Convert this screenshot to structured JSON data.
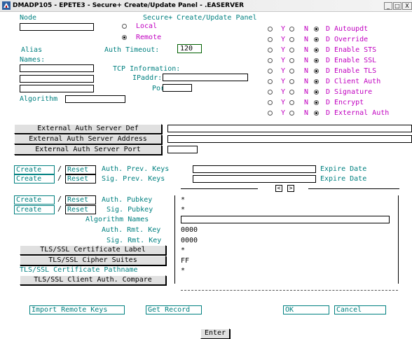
{
  "window": {
    "title": "DMADP105 - EPETE3 - Secure+ Create/Update Panel - .EASERVER",
    "minimize": "_",
    "maximize": "□",
    "close": "X"
  },
  "panel_title": "Secure+ Create/Update Panel",
  "node": {
    "label": "Node",
    "value": ""
  },
  "location": {
    "local": "Local",
    "remote": "Remote",
    "selected": "remote"
  },
  "alias": {
    "label": "Alias"
  },
  "auth_timeout": {
    "label": "Auth Timeout:",
    "value": "120"
  },
  "names": {
    "label": "Names:"
  },
  "tcp": {
    "label": "TCP Information:",
    "ipaddr_label": "IPaddr:",
    "port_label": "Port:"
  },
  "algorithm": {
    "label": "Algorithm"
  },
  "options": {
    "y": "Y",
    "n": "N",
    "d": "D",
    "items": [
      {
        "label": "Autoupdt",
        "selected": "N"
      },
      {
        "label": "Override",
        "selected": "N"
      },
      {
        "label": "Enable STS",
        "selected": "N"
      },
      {
        "label": "Enable SSL",
        "selected": "N"
      },
      {
        "label": "Enable TLS",
        "selected": "N"
      },
      {
        "label": "Client Auth",
        "selected": "N"
      },
      {
        "label": "Signature",
        "selected": "N"
      },
      {
        "label": "Encrypt",
        "selected": "N"
      },
      {
        "label": "External Auth",
        "selected": "N"
      }
    ]
  },
  "external_auth": {
    "server_def": "External Auth Server Def",
    "server_address": "External Auth Server Address",
    "server_port": "External Auth Server Port"
  },
  "keys": {
    "create": "Create",
    "reset": "Reset",
    "slash": "/",
    "auth_prev_keys": "Auth. Prev. Keys",
    "sig_prev_keys": "Sig. Prev. Keys",
    "expire_date": "Expire Date",
    "auth_pubkey": "Auth. Pubkey",
    "sig_pubkey": "Sig. Pubkey",
    "auth_pubkey_value": "*",
    "sig_pubkey_value": "*"
  },
  "details": {
    "algorithm_names": "Algorithm Names",
    "auth_rmt_key": "Auth. Rmt. Key",
    "auth_rmt_key_value": "0000",
    "sig_rmt_key": "Sig. Rmt. Key",
    "sig_rmt_key_value": "0000",
    "cert_label": "TLS/SSL Certificate Label",
    "cert_label_value": "*",
    "cipher_suites": "TLS/SSL Cipher Suites",
    "cipher_suites_value": "FF",
    "cert_pathname": "TLS/SSL Certificate Pathname",
    "cert_pathname_value": "*",
    "client_auth_compare": "TLS/SSL Client Auth. Compare"
  },
  "scroll": {
    "left": "<",
    "right": ">"
  },
  "actions": {
    "import_remote_keys": "Import Remote Keys",
    "get_record": "Get Record",
    "ok": "OK",
    "cancel": "Cancel",
    "enter": "Enter"
  },
  "colors": {
    "field_label": "#008080",
    "option_label": "#c000c0",
    "frame_bg": "#ffffff"
  }
}
